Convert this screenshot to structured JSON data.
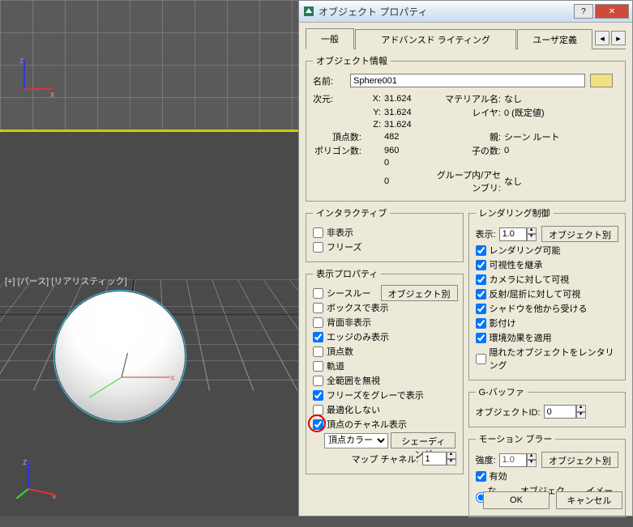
{
  "viewport": {
    "label": "[+] [パース] [リアリスティック]"
  },
  "dialog": {
    "title": "オブジェクト プロパティ",
    "help": "?",
    "close": "✕",
    "tabs": {
      "general": "一般",
      "advanced": "アドバンスド ライティング",
      "user": "ユーザ定義",
      "prev": "◂",
      "next": "▸"
    },
    "footer": {
      "ok": "OK",
      "cancel": "キャンセル"
    }
  },
  "obj_info": {
    "legend": "オブジェクト情報",
    "name_lbl": "名前:",
    "name": "Sphere001",
    "dim_lbl": "次元:",
    "x_lbl": "X:",
    "x": "31.624",
    "y_lbl": "Y:",
    "y": "31.624",
    "z_lbl": "Z:",
    "z": "31.624",
    "mat_lbl": "マテリアル名:",
    "mat": "なし",
    "layer_lbl": "レイヤ:",
    "layer": "0 (既定値)",
    "verts_lbl": "頂点数:",
    "verts": "482",
    "faces_lbl": "ポリゴン数:",
    "faces": "960",
    "zero1": "0",
    "zero2": "0",
    "parent_lbl": "親:",
    "parent": "シーン ルート",
    "children_lbl": "子の数:",
    "children": "0",
    "group_lbl": "グループ内/アセンブリ:",
    "group": "なし"
  },
  "interactive": {
    "legend": "インタラクティブ",
    "hide": "非表示",
    "freeze": "フリーズ"
  },
  "display": {
    "legend": "表示プロパティ",
    "by_object": "オブジェクト別",
    "see_through": "シースルー",
    "box": "ボックスで表示",
    "backface": "背面非表示",
    "edges": "エッジのみ表示",
    "vticks": "頂点数",
    "traj": "軌道",
    "ignore_ext": "全範囲を無視",
    "freeze_gray": "フリーズをグレーで表示",
    "no_degrade": "最適化しない",
    "vchannel": "頂点のチャネル表示",
    "vcolor": "頂点カラー",
    "shading_btn": "シェーディング",
    "map_ch_lbl": "マップ チャネル:",
    "map_ch": "1"
  },
  "render": {
    "legend": "レンダリング制御",
    "visibility_lbl": "表示:",
    "visibility": "1.0",
    "by_object": "オブジェクト別",
    "renderable": "レンダリング可能",
    "inherit_vis": "可視性を継承",
    "vis_cam": "カメラに対して可視",
    "vis_refl": "反射/屈折に対して可視",
    "recv_shadow": "シャドウを他から受ける",
    "cast_shadow": "影付け",
    "atmos": "環境効果を適用",
    "occluded": "隠れたオブジェクトをレンタリング"
  },
  "gbuffer": {
    "legend": "G-バッファ",
    "id_lbl": "オブジェクトID:",
    "id": "0"
  },
  "mblur": {
    "legend": "モーション ブラー",
    "mult_lbl": "強度:",
    "mult": "1.0",
    "by_object": "オブジェクト別",
    "enabled": "有効",
    "none": "なし",
    "object": "オブジェクト",
    "image": "イメージ"
  }
}
